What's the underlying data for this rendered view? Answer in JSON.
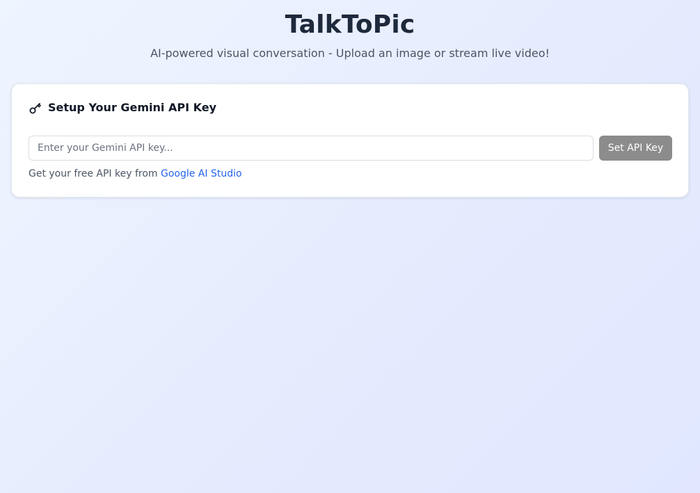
{
  "header": {
    "title": "TalkToPic",
    "subtitle": "AI-powered visual conversation - Upload an image or stream live video!"
  },
  "api_card": {
    "icon": "key-icon",
    "title": "Setup Your Gemini API Key",
    "input_placeholder": "Enter your Gemini API key...",
    "input_value": "",
    "button_label": "Set API Key",
    "help_prefix": "Get your free API key from ",
    "help_link": "Google AI Studio"
  },
  "colors": {
    "title": "#1e293b",
    "link": "#2563eb",
    "button_disabled": "#8c8c8c",
    "background_start": "#eff5ff",
    "background_end": "#e0e7ff"
  }
}
